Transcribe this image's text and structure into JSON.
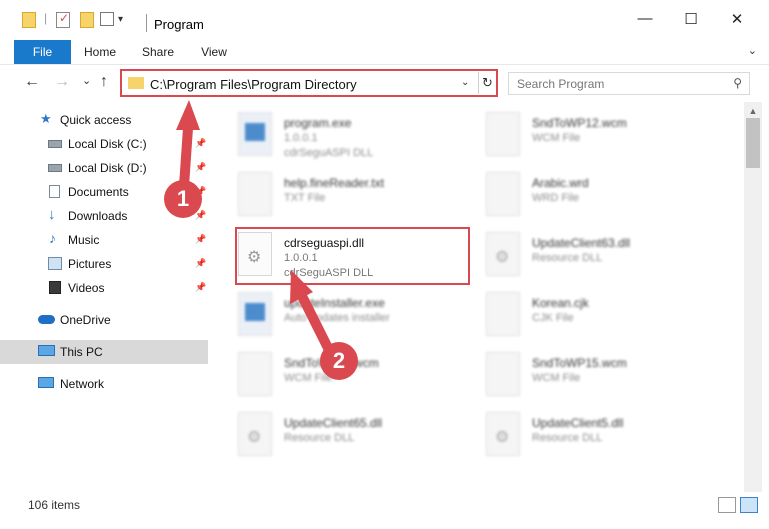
{
  "window": {
    "title": "Program",
    "minimize_glyph": "—",
    "maximize_glyph": "☐",
    "close_glyph": "✕"
  },
  "ribbon": {
    "tabs": [
      "File",
      "Home",
      "Share",
      "View"
    ],
    "expand_glyph": "⌄"
  },
  "nav": {
    "back_glyph": "←",
    "forward_glyph": "→",
    "recent_glyph": "⌄",
    "up_glyph": "↑"
  },
  "address": {
    "path": "C:\\Program Files\\Program Directory",
    "dropdown_glyph": "⌄",
    "refresh_glyph": "↻"
  },
  "search": {
    "placeholder": "Search Program",
    "icon_glyph": "⚲"
  },
  "sidebar": {
    "items": [
      {
        "label": "Quick access",
        "icon": "star-icon",
        "pinned": false
      },
      {
        "label": "Local Disk (C:)",
        "icon": "drive-icon",
        "pinned": true
      },
      {
        "label": "Local Disk (D:)",
        "icon": "drive-icon",
        "pinned": true
      },
      {
        "label": "Documents",
        "icon": "documents-icon",
        "pinned": true
      },
      {
        "label": "Downloads",
        "icon": "download-icon",
        "pinned": true
      },
      {
        "label": "Music",
        "icon": "music-icon",
        "pinned": true
      },
      {
        "label": "Pictures",
        "icon": "pictures-icon",
        "pinned": true
      },
      {
        "label": "Videos",
        "icon": "videos-icon",
        "pinned": true
      },
      {
        "label": "OneDrive",
        "icon": "cloud-icon",
        "pinned": false
      },
      {
        "label": "This PC",
        "icon": "computer-icon",
        "pinned": false,
        "selected": true
      },
      {
        "label": "Network",
        "icon": "network-icon",
        "pinned": false
      }
    ],
    "pin_glyph": "📌"
  },
  "files": {
    "left": [
      {
        "name": "program.exe",
        "line2": "1.0.0.1",
        "line3": "cdrSeguASPI DLL",
        "icon": "exe-icon"
      },
      {
        "name": "help.fineReader.txt",
        "line2": "TXT File",
        "line3": "",
        "icon": "text-file-icon"
      },
      {
        "name": "cdrseguaspi.dll",
        "line2": "1.0.0.1",
        "line3": "cdrSeguASPI DLL",
        "icon": "dll-gear-icon",
        "highlighted": true
      },
      {
        "name": "updateInstaller.exe",
        "line2": "Auto updates installer",
        "line3": "",
        "icon": "exe-icon"
      },
      {
        "name": "SndToWP14.wcm",
        "line2": "WCM File",
        "line3": "",
        "icon": "file-icon"
      },
      {
        "name": "UpdateClient65.dll",
        "line2": "Resource DLL",
        "line3": "",
        "icon": "dll-gear-icon"
      }
    ],
    "right": [
      {
        "name": "SndToWP12.wcm",
        "line2": "WCM File",
        "line3": "",
        "icon": "file-icon"
      },
      {
        "name": "Arabic.wrd",
        "line2": "WRD File",
        "line3": "",
        "icon": "file-icon"
      },
      {
        "name": "UpdateClient63.dll",
        "line2": "Resource DLL",
        "line3": "",
        "icon": "dll-gear-icon"
      },
      {
        "name": "Korean.cjk",
        "line2": "CJK File",
        "line3": "",
        "icon": "file-icon"
      },
      {
        "name": "SndToWP15.wcm",
        "line2": "WCM File",
        "line3": "",
        "icon": "file-icon"
      },
      {
        "name": "UpdateClient5.dll",
        "line2": "Resource DLL",
        "line3": "",
        "icon": "dll-gear-icon"
      }
    ]
  },
  "status": {
    "item_count": "106 items"
  },
  "callouts": {
    "step1": "1",
    "step2": "2"
  },
  "colors": {
    "accent": "#1979ca",
    "highlight_red": "#d9494f",
    "selected_bg": "#d9d9d9"
  }
}
